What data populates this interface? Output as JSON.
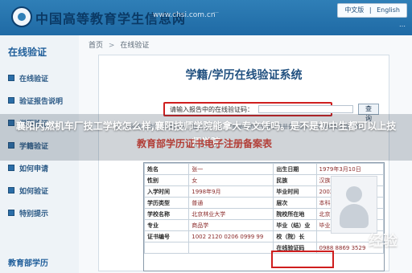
{
  "header": {
    "site_title": "中国高等教育学生信息网",
    "site_url": "www.chsi.com.cn",
    "slogan": "…",
    "lang_cn": "中文版",
    "lang_sep": "|",
    "lang_en": "English",
    "date_text": "…"
  },
  "left": {
    "title": "在线验证",
    "items": [
      {
        "label": "在线验证"
      },
      {
        "label": "验证报告说明"
      },
      {
        "label": "学历验证"
      },
      {
        "label": "学籍验证"
      },
      {
        "label": "如何申请"
      },
      {
        "label": "如何验证"
      },
      {
        "label": "特别提示"
      }
    ],
    "footer": "教育部学历"
  },
  "main": {
    "breadcrumb": {
      "home": "首页",
      "sep": ">",
      "current": "在线验证"
    },
    "title": "学籍/学历在线验证系统",
    "search": {
      "label": "请输入报告中的在线验证码：",
      "value": "",
      "button": "查询"
    },
    "note": "注：本系统为验证报告的唯一验证入口，以《教育部学历证书电子注册备案表》上中文和英文版为准。"
  },
  "overlay": {
    "headline": "襄阳内燃机车厂技工学校怎么样,襄阳技师学院能拿大专文凭吗。是不是初中生都可以上技师学院"
  },
  "certificate": {
    "header": "教育部学历证书电子注册备案表",
    "rows": [
      {
        "k1": "姓名",
        "v1": "张一",
        "k2": "出生日期",
        "v2": "1979年3月10日"
      },
      {
        "k1": "性别",
        "v1": "女",
        "k2": "民族",
        "v2": "汉族"
      },
      {
        "k1": "入学时间",
        "v1": "1998年9月",
        "k2": "毕业时间",
        "v2": "2002年7月"
      },
      {
        "k1": "学历类型",
        "v1": "普通",
        "k2": "层次",
        "v2": "本科"
      },
      {
        "k1": "学校名称",
        "v1": "北京林业大学",
        "k2": "院校所在地",
        "v2": "北京"
      },
      {
        "k1": "专业",
        "v1": "商品学",
        "k2": "毕业（结）业",
        "v2": "毕业"
      },
      {
        "k1": "证书编号",
        "v1": "1002 2120 0206 0999 99",
        "k2": "校（院）长",
        "v2": ""
      },
      {
        "k1": "",
        "v1": "",
        "k2": "在线验证码",
        "v2": "0988 8869 3529"
      }
    ],
    "watermark": "经验"
  }
}
